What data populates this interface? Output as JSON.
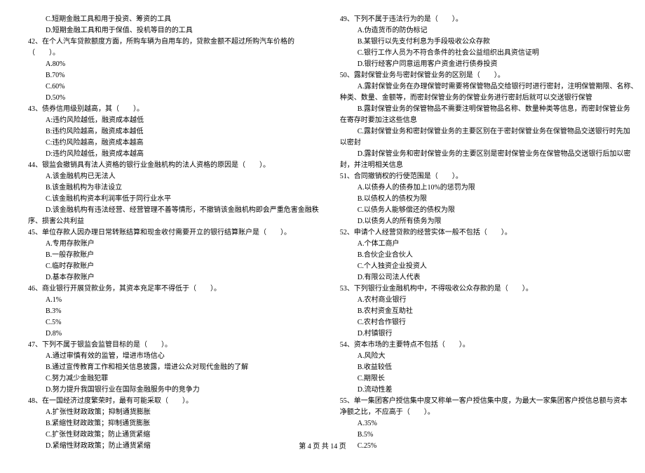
{
  "footer": "第 4 页 共 14 页",
  "left": {
    "pre_options": [
      "C.短期金融工具和用于投资、筹资的工具",
      "D.短期金融工具和用于保值、投机等目的的工具"
    ],
    "q42": {
      "stem1": "42、在个人汽车贷款额度方面，所购车辆为自用车的，贷款金额不超过所购汽车价格的",
      "stem2": "（　　）。",
      "opts": [
        "A.80%",
        "B.70%",
        "C.60%",
        "D.50%"
      ]
    },
    "q43": {
      "stem": "43、债券信用级别越高，其（　　）。",
      "opts": [
        "A:违约风险越低，融资成本越低",
        "B:违约风险越高，融资成本越低",
        "C:违约风险越高，融资成本越高",
        "D:违约风险越低，融资成本越高"
      ]
    },
    "q44": {
      "stem": "44、银监会撤销具有法人资格的银行业金融机构的法人资格的原因是（　　）。",
      "opts": [
        "A.该金融机构已无法人",
        "B.该金融机构为非法设立",
        "C.该金融机构资本利润率低于同行业水平",
        "D.该金融机构有违法经营、经营管理不善等情形，不撤销该金融机构即会严重危害金融秩"
      ],
      "tail": "序、损害公共利益"
    },
    "q45": {
      "stem": "45、单位存款人因办理日常转账结算和现金收付需要开立的银行结算账户是（　　）。",
      "opts": [
        "A.专用存款账户",
        "B.一般存款账户",
        "C.临时存款账户",
        "D.基本存款账户"
      ]
    },
    "q46": {
      "stem": "46、商业银行开展贷款业务，其资本充足率不得低于（　　）。",
      "opts": [
        "A.1%",
        "B.3%",
        "C.5%",
        "D.8%"
      ]
    },
    "q47": {
      "stem": "47、下列不属于银监会监管目标的是（　　）。",
      "opts": [
        "A.通过审慎有效的监管，增进市场信心",
        "B.通过宣传教育工作和相关信息披露，增进公众对现代金融的了解",
        "C.努力减少金融犯罪",
        "D.努力提升我国银行业在国际金融服务中的竞争力"
      ]
    },
    "q48": {
      "stem": "48、在一国经济过度繁荣时，最有可能采取（　　）。",
      "opts": [
        "A.扩张性财政政策；抑制通货膨胀",
        "B.紧缩性财政政策；抑制通货膨胀",
        "C.扩张性财政政策；防止通货紧缩",
        "D.紧缩性财政政策；防止通货紧缩"
      ]
    }
  },
  "right": {
    "q49": {
      "stem": "49、下列不属于违法行为的是（　　）。",
      "opts": [
        "A.伪造货币的防伪标记",
        "B.某银行以先支付利息为手段吸收公众存款",
        "C.银行工作人员为不符合条件的社会公益组织出具资信证明",
        "D.银行经客户同意运用客户资金进行债券投资"
      ]
    },
    "q50": {
      "stem": "50、露封保管业务与密封保管业务的区别是（　　）。",
      "opts": [
        "A.露封保管业务在办理保管时需要将保管物品交给银行时进行密封，注明保管期限、名称、",
        "B.露封保管业务的保管物品不需要注明保管物品名称、数量种类等信息，而密封保管业务",
        "C.露封保管业务和密封保管业务的主要区别在于密封保管业务在保管物品交送银行时先加",
        "D.露封保管业务和密封保管业务的主要区别是密封保管业务在保管物品交送银行后加以密"
      ],
      "cont1": "种类、数量、金额等，而密封保管业务的保管业务进行密封后就可以交送银行保管",
      "cont2": "在寄存时要加注这些信息",
      "cont3": "以密封",
      "cont4": "封，并注明相关信息"
    },
    "q51": {
      "stem": "51、合同撤销权的行使范围是（　　）。",
      "opts": [
        "A.以债券人的债券加上10%的惩罚为限",
        "B.以债权人的债权为限",
        "C.以债务人能够偿还的债权为限",
        "D.以债务人的所有债务为限"
      ]
    },
    "q52": {
      "stem": "52、申请个人经营贷款的经营实体一般不包括（　　）。",
      "opts": [
        "A.个体工商户",
        "B.合伙企业合伙人",
        "C.个人独资企业投资人",
        "D.有限公司法人代表"
      ]
    },
    "q53": {
      "stem": "53、下列银行业金融机构中，不得吸收公众存款的是（　　）。",
      "opts": [
        "A.农村商业银行",
        "B.农村资金互助社",
        "C.农村合作银行",
        "D.村镇银行"
      ]
    },
    "q54": {
      "stem": "54、资本市场的主要特点不包括（　　）。",
      "opts": [
        "A.风险大",
        "B.收益较低",
        "C.期限长",
        "D.流动性差"
      ]
    },
    "q55": {
      "stem1": "55、单一集团客户授信集中度又称单一客户授信集中度，为最大一家集团客户授信总额与资本",
      "stem2": "净额之比，不应高于（　　）。",
      "opts": [
        "A.35%",
        "B.5%",
        "C.25%"
      ]
    }
  }
}
